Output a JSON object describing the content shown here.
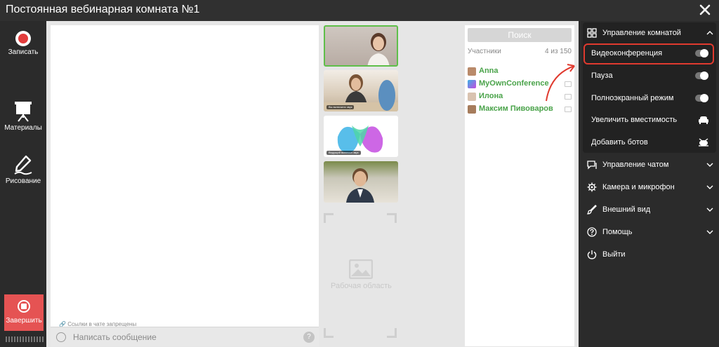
{
  "window": {
    "title": "Постоянная вебинарная комната №1"
  },
  "leftbar": {
    "record_label": "Записать",
    "materials_label": "Материалы",
    "draw_label": "Рисование",
    "stop_label": "Завершить"
  },
  "chat": {
    "links_warning": "Ссылки в чате запрещены",
    "placeholder": "Написать сообщение"
  },
  "videos": {
    "tiles": [
      {
        "caption": ""
      },
      {
        "caption": "Вы включили звук"
      },
      {
        "caption": "Ведущий включил звук"
      },
      {
        "caption": ""
      }
    ],
    "work_area_label": "Рабочая область"
  },
  "participants": {
    "search_label": "Поиск",
    "header_label": "Участники",
    "count": "4 из 150",
    "items": [
      {
        "name": "Anna"
      },
      {
        "name": "MyOwnConference"
      },
      {
        "name": "Илона"
      },
      {
        "name": "Максим Пивоваров"
      }
    ]
  },
  "menu": {
    "room_control": {
      "label": "Управление комнатой",
      "items": [
        {
          "label": "Видеоконференция"
        },
        {
          "label": "Пауза"
        },
        {
          "label": "Полноэкранный режим"
        },
        {
          "label": "Увеличить вместимость"
        },
        {
          "label": "Добавить ботов"
        }
      ]
    },
    "chat_control": {
      "label": "Управление чатом"
    },
    "camera_mic": {
      "label": "Камера и микрофон"
    },
    "appearance": {
      "label": "Внешний вид"
    },
    "help": {
      "label": "Помощь"
    },
    "exit": {
      "label": "Выйти"
    }
  },
  "colors": {
    "accent_green": "#4aa34a",
    "stop_red": "#e55353",
    "highlight_red": "#e03a2f"
  }
}
